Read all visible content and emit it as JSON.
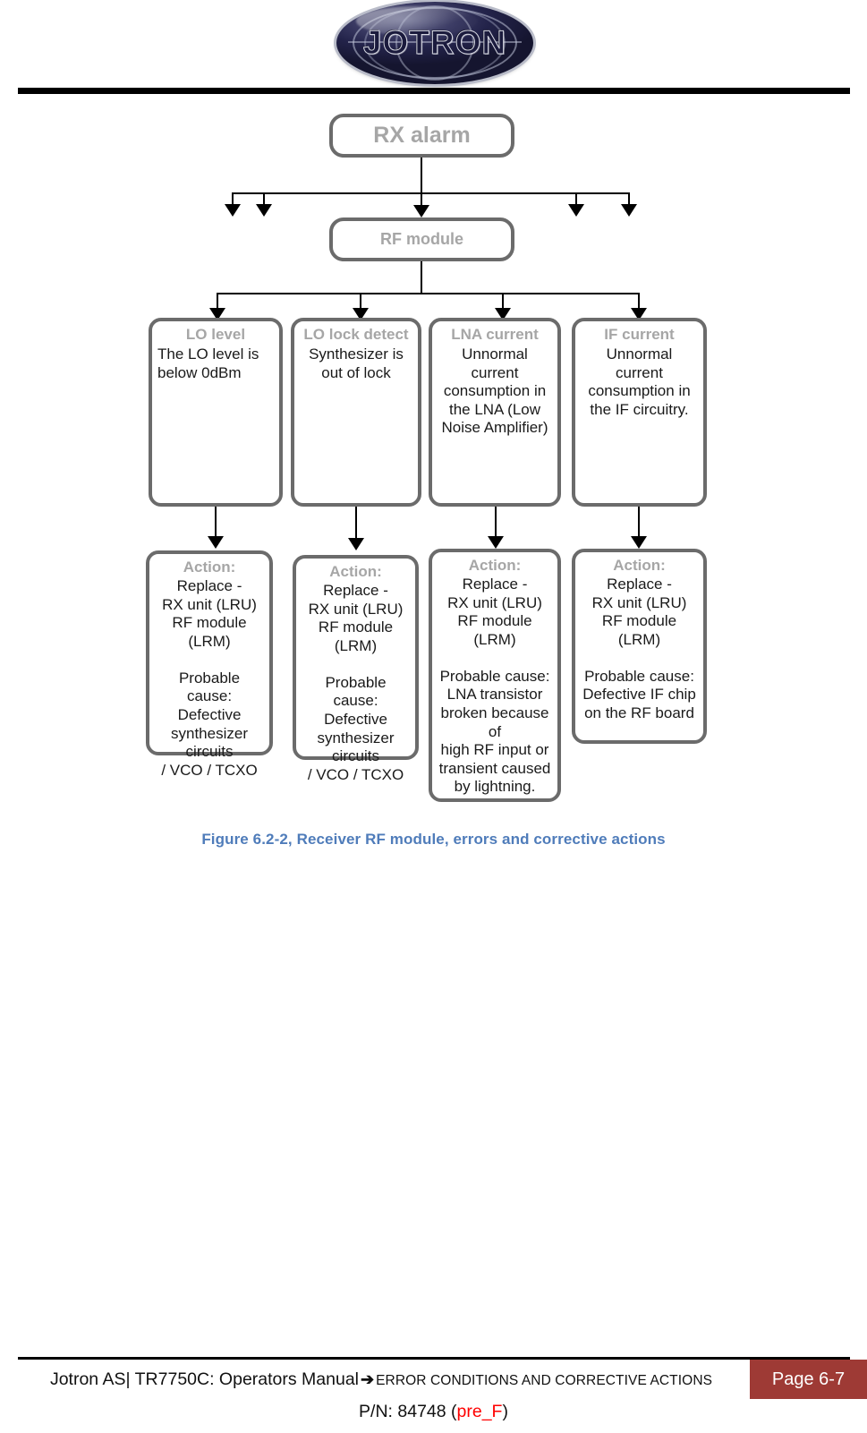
{
  "header": {
    "logo_text": "JOTRON",
    "logo_name": "jotron-logo"
  },
  "flowchart": {
    "root": {
      "title": "RX alarm"
    },
    "module": {
      "title": "RF module"
    },
    "conditions": [
      {
        "header": "LO level",
        "body": "The LO level is below 0dBm"
      },
      {
        "header": "LO lock detect",
        "body": "Synthesizer is out of lock"
      },
      {
        "header": "LNA current",
        "body": "Unnormal current consumption in the LNA (Low Noise Amplifier)"
      },
      {
        "header": "IF current",
        "body": "Unnormal current consumption in the IF circuitry."
      }
    ],
    "actions": [
      {
        "header": "Action:",
        "body": "Replace -\nRX unit (LRU)\nRF module (LRM)\n\nProbable cause:\nDefective\nsynthesizer circuits\n/ VCO / TCXO"
      },
      {
        "header": "Action:",
        "body": "Replace -\nRX unit (LRU)\nRF  module (LRM)\n\nProbable cause:\nDefective\nsynthesizer circuits\n/ VCO / TCXO"
      },
      {
        "header": "Action:",
        "body": "Replace -\nRX unit (LRU)\nRF module (LRM)\n\nProbable cause:\nLNA transistor\nbroken because of\nhigh RF input or\ntransient caused\nby lightning."
      },
      {
        "header": "Action:",
        "body": "Replace -\nRX unit (LRU)\nRF module (LRM)\n\nProbable cause:\nDefective IF chip\non the RF board"
      }
    ]
  },
  "caption": "Figure 6.2-2, Receiver RF module, errors and corrective actions",
  "footer": {
    "company_doc": "Jotron AS| TR7750C: Operators Manual",
    "arrow": "➔",
    "section": "ERROR CONDITIONS AND CORRECTIVE ACTIONS",
    "page_label": "Page 6-7",
    "pn_prefix": "P/N: 84748 (",
    "pn_revision": "pre_F",
    "pn_suffix": ")"
  },
  "colors": {
    "node_border": "#6b6b6b",
    "node_header_text": "#a6a6a6",
    "caption_blue": "#4f7cba",
    "badge_red": "#9e3a35",
    "revision_red": "#ff0000"
  }
}
